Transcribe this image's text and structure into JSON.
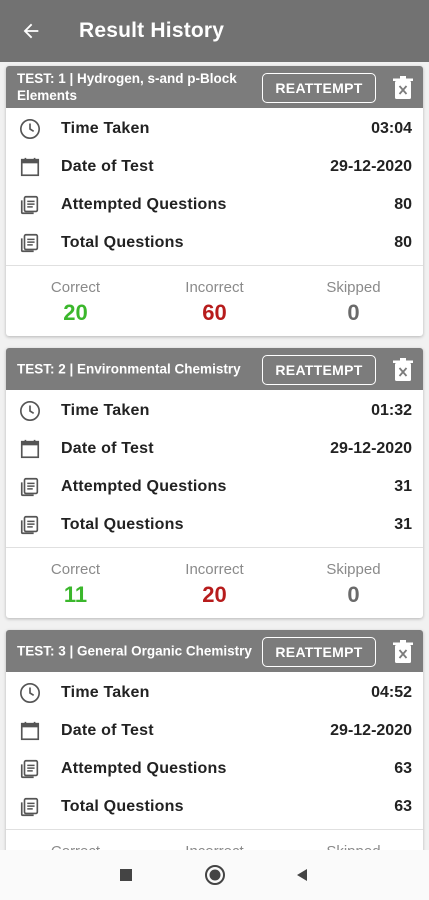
{
  "appbar": {
    "title": "Result History",
    "back_icon": "arrow-left-icon"
  },
  "colors": {
    "appbar": "#727272",
    "card_header": "#7c7c7c",
    "correct": "#3bb72c",
    "incorrect": "#b71c1c",
    "skipped": "#6a6a6a"
  },
  "reattempt_label": "REATTEMPT",
  "labels": {
    "time_taken": "Time Taken",
    "date_of_test": "Date of Test",
    "attempted": "Attempted Questions",
    "total": "Total Questions",
    "correct": "Correct",
    "incorrect": "Incorrect",
    "skipped": "Skipped"
  },
  "tests": [
    {
      "title": "TEST: 1 | Hydrogen, s-and p-Block Elements",
      "time_taken": "03:04",
      "date": "29-12-2020",
      "attempted": "80",
      "total": "80",
      "correct": "20",
      "incorrect": "60",
      "skipped": "0"
    },
    {
      "title": "TEST: 2 | Environmental Chemistry",
      "time_taken": "01:32",
      "date": "29-12-2020",
      "attempted": "31",
      "total": "31",
      "correct": "11",
      "incorrect": "20",
      "skipped": "0"
    },
    {
      "title": "TEST: 3 | General Organic Chemistry",
      "time_taken": "04:52",
      "date": "29-12-2020",
      "attempted": "63",
      "total": "63",
      "correct": "",
      "incorrect": "",
      "skipped": ""
    }
  ],
  "navbar": {
    "recents_icon": "square-icon",
    "home_icon": "circle-icon",
    "back_icon": "triangle-back-icon"
  }
}
